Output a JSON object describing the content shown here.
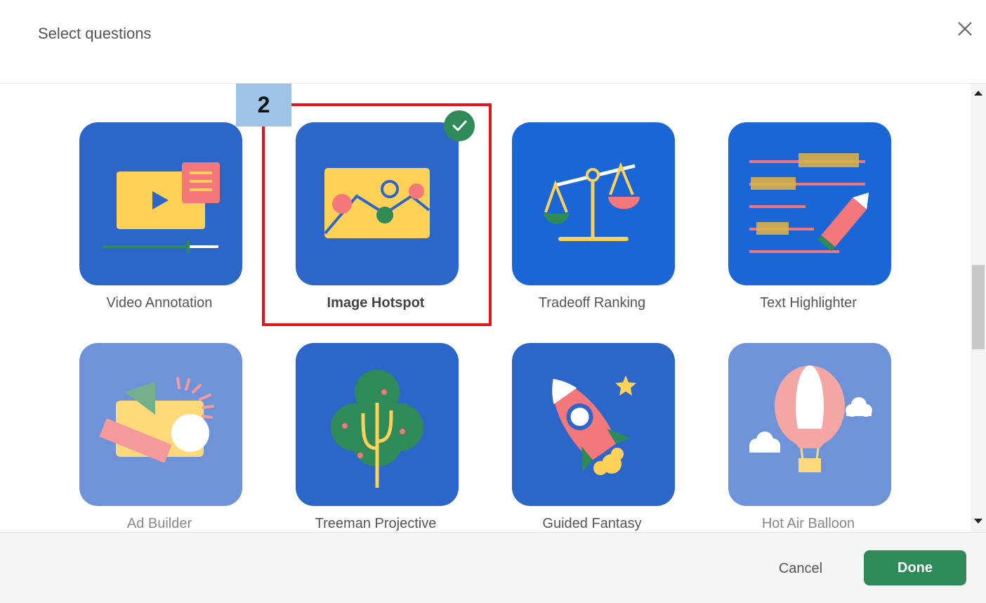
{
  "dialog": {
    "title": "Select questions"
  },
  "annotation": {
    "step_number": "2"
  },
  "cards": [
    {
      "label": "Video Annotation",
      "selected": false,
      "enabled": true
    },
    {
      "label": "Image Hotspot",
      "selected": true,
      "enabled": true
    },
    {
      "label": "Tradeoff Ranking",
      "selected": false,
      "enabled": true
    },
    {
      "label": "Text Highlighter",
      "selected": false,
      "enabled": true
    },
    {
      "label": "Ad Builder",
      "selected": false,
      "enabled": false
    },
    {
      "label": "Treeman Projective",
      "selected": false,
      "enabled": true
    },
    {
      "label": "Guided Fantasy",
      "selected": false,
      "enabled": true
    },
    {
      "label": "Hot Air Balloon",
      "selected": false,
      "enabled": false
    }
  ],
  "footer": {
    "cancel_label": "Cancel",
    "done_label": "Done"
  },
  "colors": {
    "card_blue": "#2d66c9",
    "card_blue_dark": "#1a66d6",
    "card_faded": "#6f93d8",
    "accent_green": "#2e8a57",
    "highlight_red": "#e3141b",
    "step_badge": "#9dc3e6"
  }
}
